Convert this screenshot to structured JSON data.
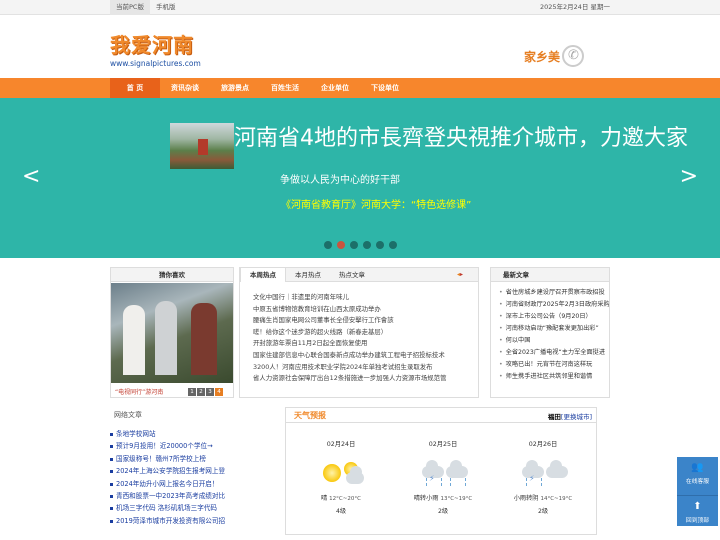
{
  "topbar": {
    "links": [
      "当前PC版",
      "手机版"
    ],
    "date": "2025年2月24日 星期一"
  },
  "header": {
    "logo_text": "我爱河南",
    "logo_url": "www.signalpictures.com",
    "ad_text": "家乡美"
  },
  "nav": {
    "items": [
      "首 页",
      "资讯杂谈",
      "旅游景点",
      "百姓生活",
      "企业单位",
      "下设单位"
    ]
  },
  "banner": {
    "headline": "河南省4地的市長齊登央視推介城市，力邀大家",
    "sub1": "争做以人民为中心的好干部",
    "sub2": "《河南省教育厅》河南大学：“特色选修课”",
    "prev_label": "<",
    "next_label": ">",
    "slide_count": 6,
    "active_slide": 2
  },
  "photo_panel": {
    "title": "猜你喜欢",
    "caption": "“电视同行”游河南",
    "pages": [
      "1",
      "2",
      "3",
      "4"
    ],
    "active_page": 4
  },
  "news_panel": {
    "tabs": [
      "本周热点",
      "本月热点",
      "热点文章"
    ],
    "arrow_left": "◂",
    "arrow_right": "▸",
    "items": [
      "文化中国行｜非遗里的河南年味儿",
      "中原五省博物馆教育培训在山西太原成功举办",
      "腰痛生肖国家电网公司董事长全侵安擊行工作會該",
      "嗟！给你这个迷步游的超火线路（新春走基层）",
      "开封旅游年票自11月2日起全面恢复使用",
      "国家住建部信息中心联合国泰新点成功举办建筑工程电子招投标技术",
      "3200人！河南应用技术职业学院2024年单独考试招生录取发布",
      "省人力资源社会保障厅出台12条措施进一步加强人力资源市场规范管"
    ]
  },
  "hot_panel": {
    "title": "最新文章",
    "items": [
      "省住房城乡建设厅召开贯察市政招投",
      "河南省财政厅2025年2月3日政府采购",
      "深市上市公司公告（9月20日）",
      "河南移动启动“豫配套发更加出彩”",
      "何以中国",
      "全省2023广播电视“主力军全面挺进",
      "攻略已出！元宵节在河南这样玩",
      "师生携手进社区共筑邻里和谐情"
    ]
  },
  "links_panel": {
    "title": "网络文章",
    "items": [
      "条地学校网站",
      "预计9月投用！近20000个学位→",
      "国家级称号！赣州7所学校上榜",
      "2024年上海公安学院招生报考网上登",
      "2024年幼升小网上报名今日开启！",
      "青西和股票一中2023年高考成绩对比",
      "机场三字代码 洛杉矶机场三字代码",
      "2019菏泽市城市开发投资有限公司招"
    ]
  },
  "weather": {
    "title": "天气预报",
    "city": "福田",
    "change_label": "[更换城市]",
    "days": [
      {
        "date": "02月24日",
        "desc": "晴",
        "temp": "12°C~20°C",
        "wind": "4级"
      },
      {
        "date": "02月25日",
        "desc": "晴转小雨",
        "temp": "13°C~19°C",
        "wind": "2级"
      },
      {
        "date": "02月26日",
        "desc": "小雨转阴",
        "temp": "14°C~19°C",
        "wind": "2级"
      }
    ]
  },
  "side_float": {
    "online_label": "在线客服",
    "top_label": "回到顶部"
  },
  "colors": {
    "orange_nav": "#f7862c",
    "banner_teal": "#2eb5a8",
    "link_blue": "#1a3da0",
    "side_blue": "#3b84c9"
  }
}
